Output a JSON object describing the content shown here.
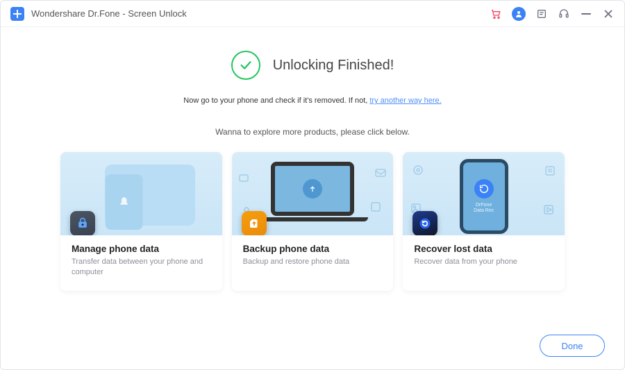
{
  "titlebar": {
    "app_title": "Wondershare Dr.Fone - Screen Unlock"
  },
  "status": {
    "title": "Unlocking Finished!",
    "sub_prefix": "Now go to your phone and check if it's removed. If not, ",
    "sub_link": "try another way here."
  },
  "explore": {
    "text": "Wanna to explore more products,  please click below."
  },
  "cards": [
    {
      "title": "Manage phone data",
      "desc": "Transfer data between your phone and computer"
    },
    {
      "title": "Backup phone data",
      "desc": "Backup and restore phone data"
    },
    {
      "title": "Recover lost data",
      "desc": "Recover data from your phone"
    }
  ],
  "footer": {
    "done_label": "Done"
  }
}
